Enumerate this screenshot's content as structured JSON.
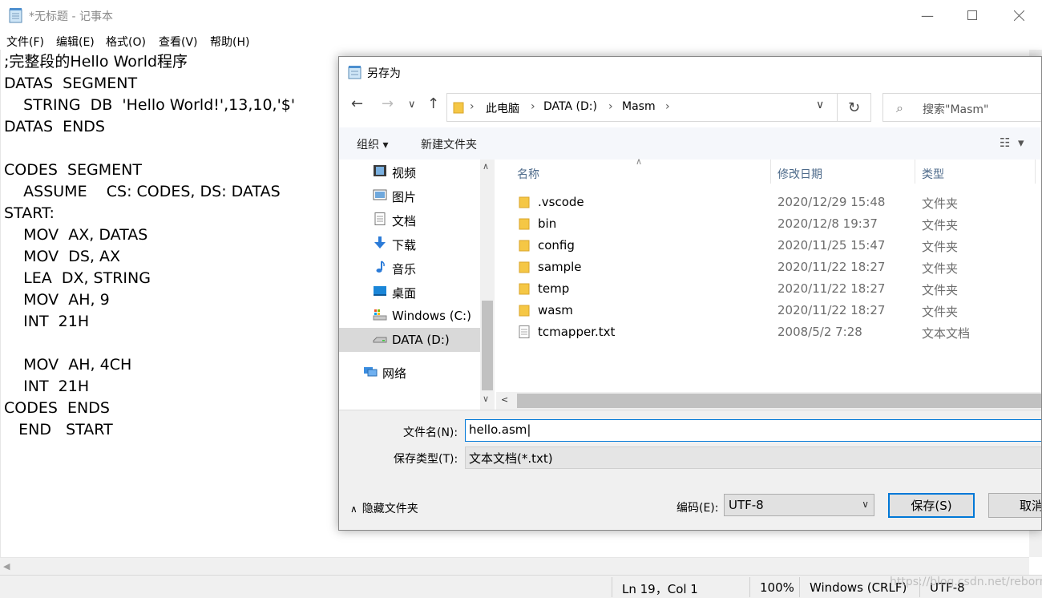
{
  "notepad": {
    "title": "*无标题 - 记事本",
    "menu": [
      "文件(F)",
      "编辑(E)",
      "格式(O)",
      "查看(V)",
      "帮助(H)"
    ],
    "content": ";完整段的Hello World程序\nDATAS  SEGMENT\n    STRING  DB  'Hello World!',13,10,'$'\nDATAS  ENDS\n\nCODES  SEGMENT\n    ASSUME    CS: CODES, DS: DATAS\nSTART:\n    MOV  AX, DATAS\n    MOV  DS, AX\n    LEA  DX, STRING\n    MOV  AH, 9\n    INT  21H\n\n    MOV  AH, 4CH\n    INT  21H\nCODES  ENDS\n   END   START",
    "status": {
      "position": "Ln 19，Col 1",
      "zoom": "100%",
      "line_ending": "Windows (CRLF)",
      "encoding": "UTF-8"
    },
    "watermark": "https://blog.csdn.net/reborn"
  },
  "dialog": {
    "title": "另存为",
    "address": [
      "此电脑",
      "DATA (D:)",
      "Masm"
    ],
    "search_placeholder": "搜索\"Masm\"",
    "toolbar": {
      "organize": "组织",
      "new_folder": "新建文件夹"
    },
    "nav_items": [
      {
        "label": "视频",
        "icon": "video-icon"
      },
      {
        "label": "图片",
        "icon": "pictures-icon"
      },
      {
        "label": "文档",
        "icon": "documents-icon"
      },
      {
        "label": "下载",
        "icon": "download-icon"
      },
      {
        "label": "音乐",
        "icon": "music-icon"
      },
      {
        "label": "桌面",
        "icon": "desktop-icon"
      },
      {
        "label": "Windows (C:)",
        "icon": "drive-c-icon"
      },
      {
        "label": "DATA (D:)",
        "icon": "drive-d-icon",
        "selected": true
      },
      {
        "label": "网络",
        "icon": "network-icon"
      }
    ],
    "columns": {
      "name": "名称",
      "modified": "修改日期",
      "type": "类型"
    },
    "files": [
      {
        "name": ".vscode",
        "modified": "2020/12/29 15:48",
        "type": "文件夹",
        "kind": "folder"
      },
      {
        "name": "bin",
        "modified": "2020/12/8 19:37",
        "type": "文件夹",
        "kind": "folder"
      },
      {
        "name": "config",
        "modified": "2020/11/25 15:47",
        "type": "文件夹",
        "kind": "folder"
      },
      {
        "name": "sample",
        "modified": "2020/11/22 18:27",
        "type": "文件夹",
        "kind": "folder"
      },
      {
        "name": "temp",
        "modified": "2020/11/22 18:27",
        "type": "文件夹",
        "kind": "folder"
      },
      {
        "name": "wasm",
        "modified": "2020/11/22 18:27",
        "type": "文件夹",
        "kind": "folder"
      },
      {
        "name": "tcmapper.txt",
        "modified": "2008/5/2 7:28",
        "type": "文本文档",
        "kind": "file"
      }
    ],
    "filename_label": "文件名(N):",
    "filename_value": "hello.asm",
    "filetype_label": "保存类型(T):",
    "filetype_value": "文本文档(*.txt)",
    "encoding_label": "编码(E):",
    "encoding_value": "UTF-8",
    "save_label": "保存(S)",
    "cancel_label": "取消",
    "hide_folders_label": "隐藏文件夹"
  }
}
